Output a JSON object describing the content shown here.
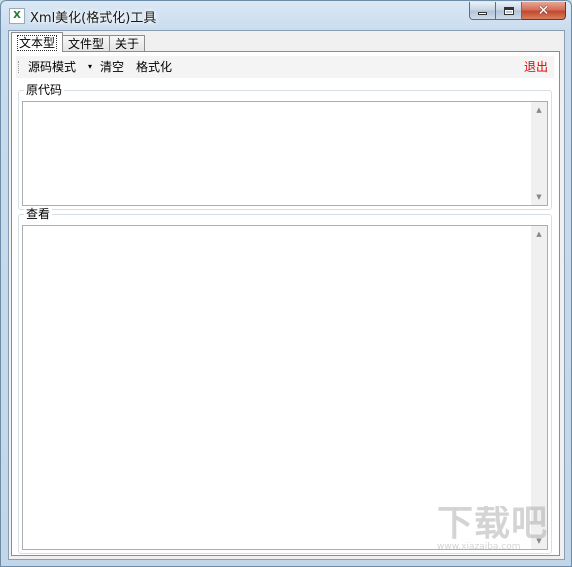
{
  "window": {
    "title": "Xml美化(格式化)工具",
    "icon_letter": "X",
    "caption_buttons": {
      "minimize": "minimize-icon",
      "maximize": "maximize-icon",
      "close": "✕"
    }
  },
  "tabs": [
    {
      "label": "文本型",
      "active": true
    },
    {
      "label": "文件型",
      "active": false
    },
    {
      "label": "关于",
      "active": false
    }
  ],
  "toolbar": {
    "mode_label": "源码模式",
    "mode_arrow": "▾",
    "clear_label": "清空",
    "format_label": "格式化",
    "exit_label": "退出",
    "exit_color": "#e00000"
  },
  "source": {
    "label": "原代码",
    "value": ""
  },
  "view": {
    "label": "查看",
    "value": ""
  },
  "scroll": {
    "up": "▲",
    "down": "▼"
  },
  "watermark": {
    "text": "下载吧",
    "sub": "www.xiazaiba.com"
  }
}
